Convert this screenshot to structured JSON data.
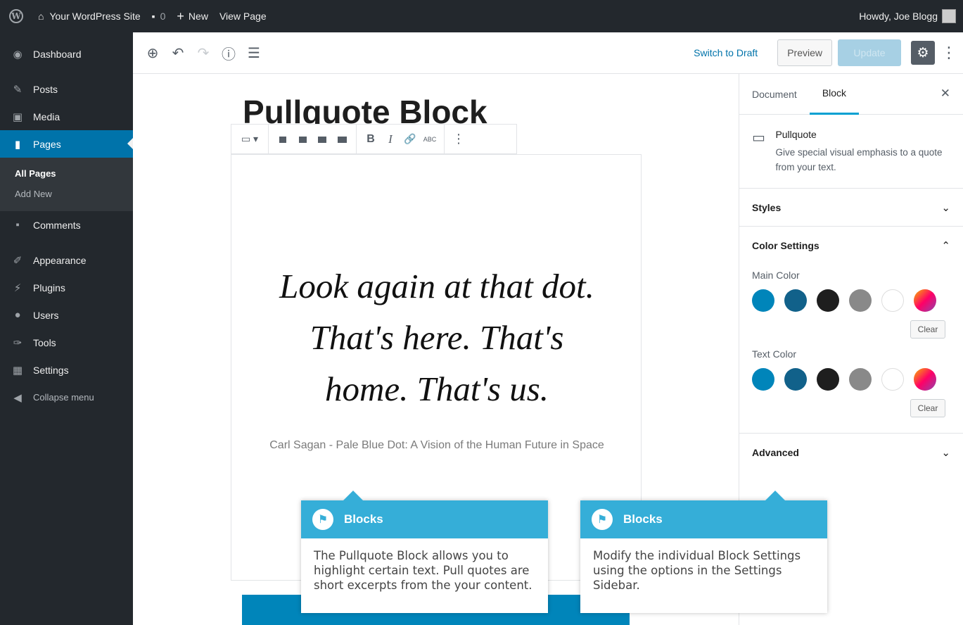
{
  "adminbar": {
    "site_name": "Your WordPress Site",
    "comments_count": "0",
    "new_label": "New",
    "view_page": "View Page",
    "howdy": "Howdy, Joe Blogg"
  },
  "sidebar": {
    "items": [
      {
        "label": "Dashboard",
        "icon": "dashboard-icon"
      },
      {
        "label": "Posts",
        "icon": "pin-icon"
      },
      {
        "label": "Media",
        "icon": "media-icon"
      },
      {
        "label": "Pages",
        "icon": "pages-icon"
      },
      {
        "label": "Comments",
        "icon": "comment-icon"
      },
      {
        "label": "Appearance",
        "icon": "brush-icon"
      },
      {
        "label": "Plugins",
        "icon": "plugin-icon"
      },
      {
        "label": "Users",
        "icon": "users-icon"
      },
      {
        "label": "Tools",
        "icon": "wrench-icon"
      },
      {
        "label": "Settings",
        "icon": "settings-icon"
      }
    ],
    "submenu": [
      "All Pages",
      "Add New"
    ],
    "collapse": "Collapse menu"
  },
  "toolbar": {
    "switch_draft": "Switch to Draft",
    "preview": "Preview",
    "update": "Update"
  },
  "editor": {
    "title": "Pullquote Block",
    "quote_lines": [
      "Look again at that dot.",
      "That's here. That's",
      "home. That's us."
    ],
    "citation": "Carl Sagan - Pale Blue Dot: A Vision of the Human Future in Space",
    "format_labels": {
      "bold": "B",
      "italic": "I",
      "strikethrough": "ABC"
    }
  },
  "settings": {
    "tab_document": "Document",
    "tab_block": "Block",
    "block_name": "Pullquote",
    "block_desc": "Give special visual emphasis to a quote from your text.",
    "styles": "Styles",
    "color_settings": "Color Settings",
    "main_color": "Main Color",
    "text_color": "Text Color",
    "clear": "Clear",
    "advanced": "Advanced",
    "swatch_colors": [
      "#0085ba",
      "#11618a",
      "#1e1e1e",
      "#898989",
      "#ffffff",
      "gradient"
    ]
  },
  "callouts": [
    {
      "title": "Blocks",
      "body": "The Pullquote Block allows you to highlight certain text. Pull quotes are short excerpts from the your content."
    },
    {
      "title": "Blocks",
      "body": "Modify the individual Block Settings using the options in the Settings Sidebar."
    }
  ],
  "colors": {
    "accent": "#0073aa",
    "admin_bg": "#23282d",
    "callout": "#35aed8"
  }
}
